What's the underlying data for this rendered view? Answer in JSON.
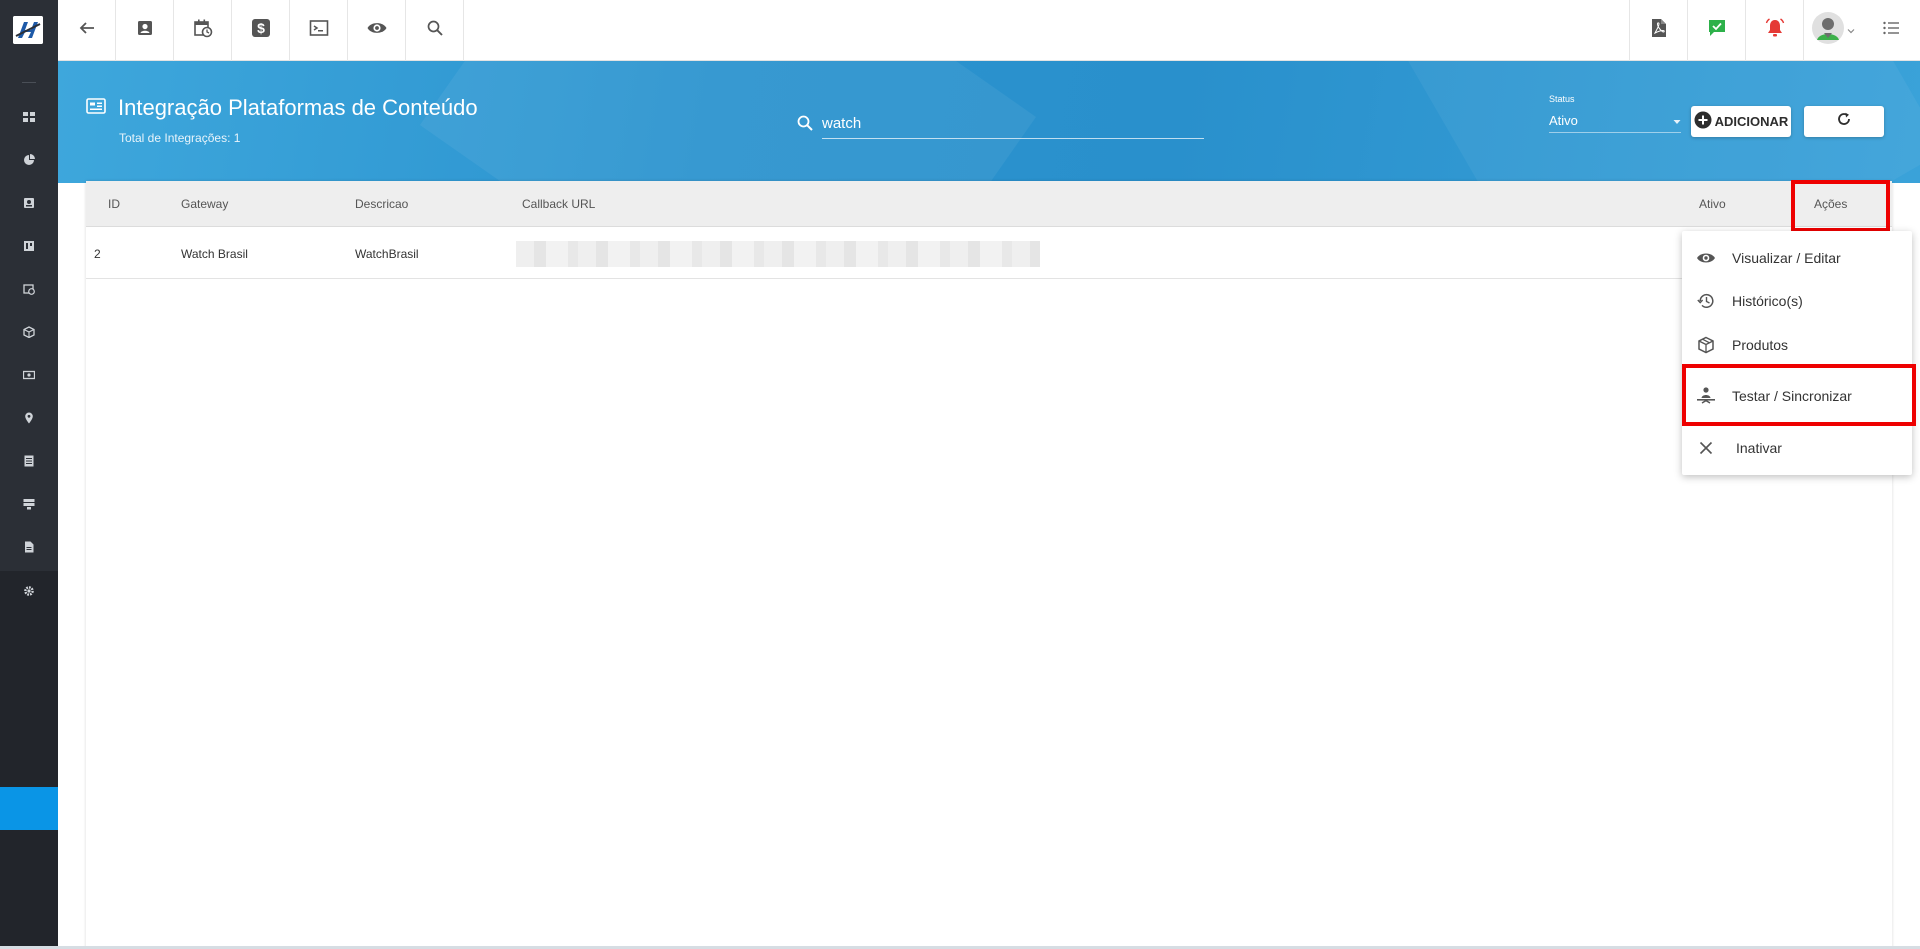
{
  "header": {
    "title": "Integração Plataformas de Conteúdo",
    "subtitle": "Total de Integrações: 1"
  },
  "search": {
    "value": "watch",
    "placeholder": ""
  },
  "status_filter": {
    "label": "Status",
    "selected": "Ativo"
  },
  "buttons": {
    "add_label": "ADICIONAR"
  },
  "table": {
    "columns": [
      "ID",
      "Gateway",
      "Descricao",
      "Callback URL",
      "Ativo",
      "Ações"
    ],
    "rows": [
      {
        "id": "2",
        "gateway": "Watch Brasil",
        "descricao": "WatchBrasil",
        "callback_url": "",
        "ativo": ""
      }
    ]
  },
  "actions_menu": {
    "items": [
      {
        "label": "Visualizar / Editar",
        "icon": "eye-icon"
      },
      {
        "label": "Histórico(s)",
        "icon": "history-icon"
      },
      {
        "label": "Produtos",
        "icon": "box-icon"
      },
      {
        "label": "Testar / Sincronizar",
        "icon": "sync-icon"
      },
      {
        "label": "Inativar",
        "icon": "close-icon"
      }
    ]
  },
  "colors": {
    "sidebar": "#2b2f36",
    "band": "#2b93cf",
    "sidebar_active": "#0a95e6",
    "highlight": "#ee0000",
    "green_check": "#2db14a",
    "red_alarm": "#e53935"
  },
  "toolbar_icons": [
    "back-arrow-icon",
    "contact-card-icon",
    "calendar-clock-icon",
    "dollar-icon",
    "terminal-icon",
    "eye-icon",
    "search-icon"
  ],
  "toolbar_right_icons": [
    "pdf-icon",
    "green-check-chat-icon",
    "red-alarm-icon",
    "user-avatar",
    "list-menu-icon"
  ]
}
